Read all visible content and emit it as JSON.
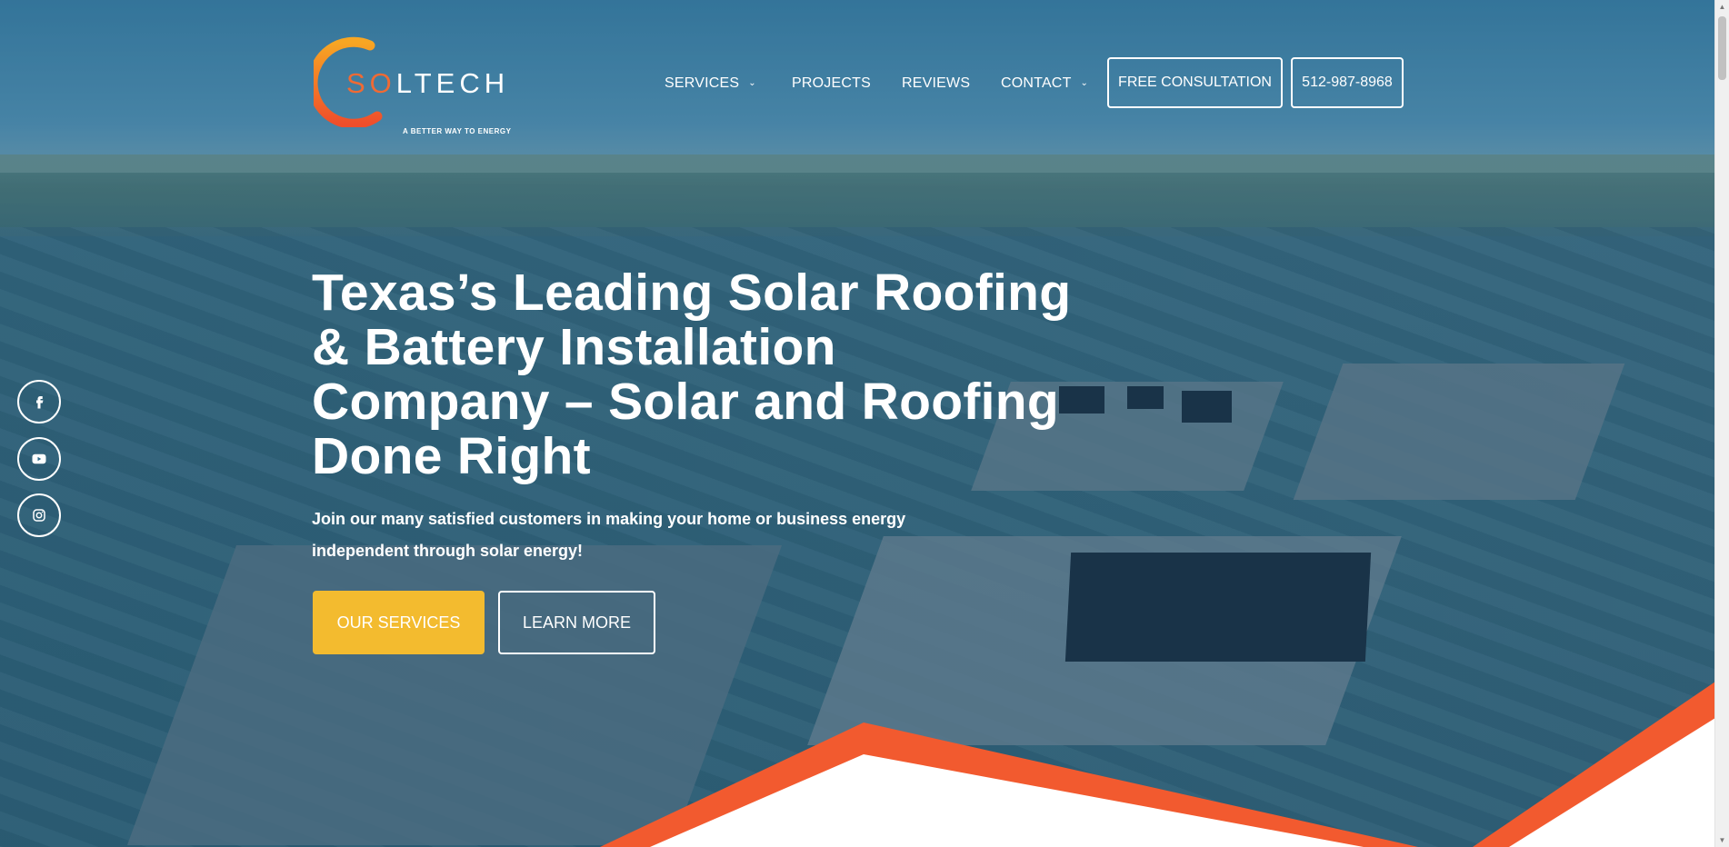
{
  "brand": {
    "logo_prefix": "SO",
    "logo_suffix": "LTECH",
    "tagline": "A BETTER WAY TO ENERGY",
    "accent_orange": "#f06a34",
    "accent_yellow": "#f3bb2f"
  },
  "nav": {
    "items": [
      {
        "label": "SERVICES",
        "has_dropdown": true
      },
      {
        "label": "PROJECTS",
        "has_dropdown": false
      },
      {
        "label": "REVIEWS",
        "has_dropdown": false
      },
      {
        "label": "CONTACT",
        "has_dropdown": true
      }
    ],
    "consultation_label": "FREE CONSULTATION",
    "phone_label": "512-987-8968"
  },
  "social": {
    "icons": [
      "facebook-icon",
      "youtube-icon",
      "instagram-icon"
    ]
  },
  "hero": {
    "headline": "Texas’s Leading Solar Roofing & Battery Installation Company – Solar and Roofing Done Right",
    "subhead": "Join our many satisfied customers in making your home or business energy independent through solar energy!",
    "primary_button": "OUR SERVICES",
    "secondary_button": "LEARN MORE"
  }
}
